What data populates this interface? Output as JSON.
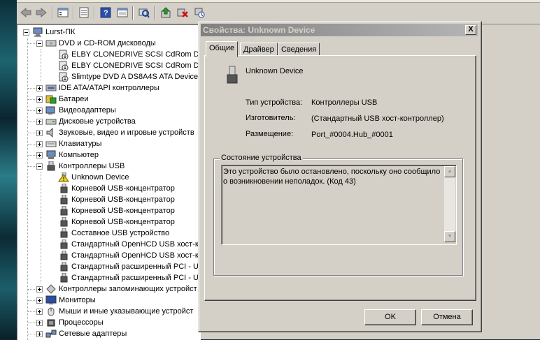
{
  "tree": {
    "root": "Lurst-ПК",
    "items": [
      {
        "label": "DVD и CD-ROM дисководы",
        "icon": "cdrom-icon",
        "expanded": true
      },
      {
        "label": "ELBY CLONEDRIVE SCSI CdRom Devi",
        "icon": "cd-drive-icon"
      },
      {
        "label": "ELBY CLONEDRIVE SCSI CdRom Devi",
        "icon": "cd-drive-icon"
      },
      {
        "label": "Slimtype DVD A  DS8A4S ATA Device",
        "icon": "cd-drive-icon"
      },
      {
        "label": "IDE ATA/ATAPI контроллеры",
        "icon": "ide-controller-icon",
        "expanded": false
      },
      {
        "label": "Батареи",
        "icon": "battery-icon",
        "expanded": false
      },
      {
        "label": "Видеоадаптеры",
        "icon": "display-adapter-icon",
        "expanded": false
      },
      {
        "label": "Дисковые устройства",
        "icon": "disk-drive-icon",
        "expanded": false
      },
      {
        "label": "Звуковые, видео и игровые устройств",
        "icon": "sound-icon",
        "expanded": false
      },
      {
        "label": "Клавиатуры",
        "icon": "keyboard-icon",
        "expanded": false
      },
      {
        "label": "Компьютер",
        "icon": "computer-icon",
        "expanded": false
      },
      {
        "label": "Контроллеры USB",
        "icon": "usb-icon",
        "expanded": true
      },
      {
        "label": "Unknown Device",
        "icon": "warning-icon"
      },
      {
        "label": "Корневой USB-концентратор",
        "icon": "usb-plug-icon"
      },
      {
        "label": "Корневой USB-концентратор",
        "icon": "usb-plug-icon"
      },
      {
        "label": "Корневой USB-концентратор",
        "icon": "usb-plug-icon"
      },
      {
        "label": "Корневой USB-концентратор",
        "icon": "usb-plug-icon"
      },
      {
        "label": "Составное USB устройство",
        "icon": "usb-plug-icon"
      },
      {
        "label": "Стандартный OpenHCD USB хост-к",
        "icon": "usb-plug-icon"
      },
      {
        "label": "Стандартный OpenHCD USB хост-к",
        "icon": "usb-plug-icon"
      },
      {
        "label": "Стандартный расширенный PCI - U",
        "icon": "usb-plug-icon"
      },
      {
        "label": "Стандартный расширенный PCI - U",
        "icon": "usb-plug-icon"
      },
      {
        "label": "Контроллеры запоминающих устройст",
        "icon": "storage-controller-icon",
        "expanded": false
      },
      {
        "label": "Мониторы",
        "icon": "monitor-icon",
        "expanded": false
      },
      {
        "label": "Мыши и иные указывающие устройст",
        "icon": "mouse-icon",
        "expanded": false
      },
      {
        "label": "Процессоры",
        "icon": "processor-icon",
        "expanded": false
      },
      {
        "label": "Сетевые адаптеры",
        "icon": "network-icon",
        "expanded": false
      }
    ]
  },
  "dialog": {
    "title": "Свойства: Unknown Device",
    "close_label": "X",
    "tabs": [
      "Общие",
      "Драйвер",
      "Сведения"
    ],
    "device_name": "Unknown Device",
    "props": [
      {
        "label": "Тип устройства:",
        "value": "Контроллеры USB"
      },
      {
        "label": "Изготовитель:",
        "value": "(Стандартный USB хост-контроллер)"
      },
      {
        "label": "Размещение:",
        "value": "Port_#0004.Hub_#0001"
      }
    ],
    "status_group_label": "Состояние устройства",
    "status_text": "Это устройство было остановлено, поскольку оно сообщило о возникновении неполадок. (Код 43)",
    "ok_label": "OK",
    "cancel_label": "Отмена"
  }
}
